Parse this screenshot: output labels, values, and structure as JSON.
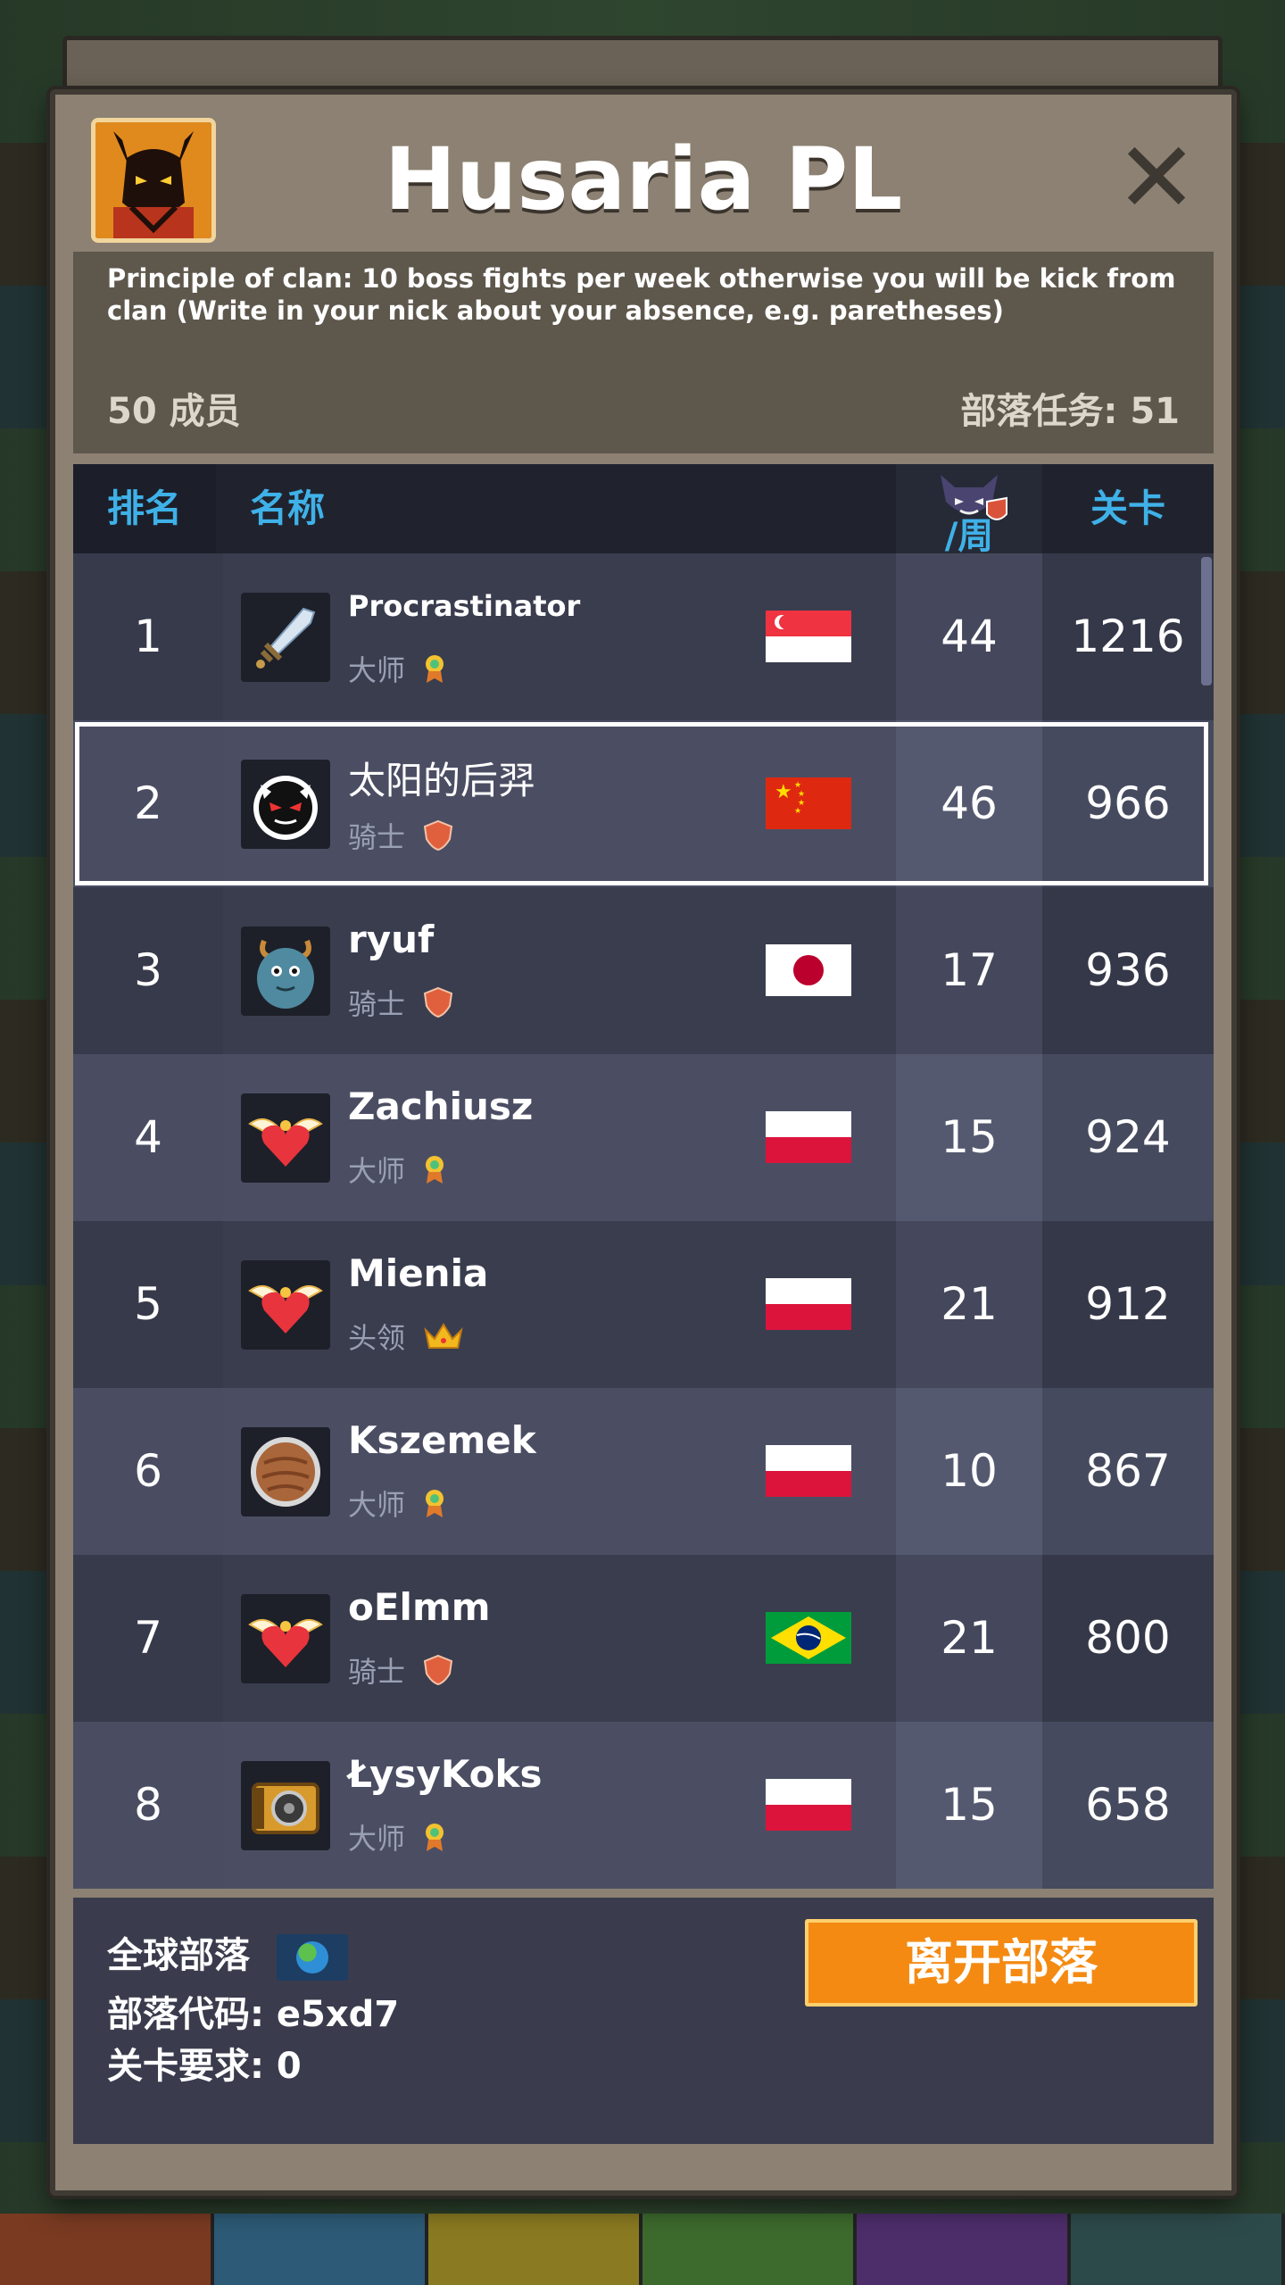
{
  "clan": {
    "name": "Husaria PL",
    "description": "Principle of clan: 10 boss fights per week otherwise you will be kick from clan (Write in your nick about your absence,  e.g. paretheses)",
    "members_text": "50 成员",
    "tasks_text": "部落任务: 51"
  },
  "table": {
    "headers": {
      "rank": "排名",
      "name": "名称",
      "week": "/周",
      "level": "关卡"
    },
    "rows": [
      {
        "rank": "1",
        "name": "Procrastinator",
        "role": "大师",
        "role_icon": "medal-icon",
        "flag": "singapore-flag",
        "week": "44",
        "level": "1216",
        "avatar": "sword-avatar"
      },
      {
        "rank": "2",
        "name": "太阳的后羿",
        "role": "骑士",
        "role_icon": "shield-icon",
        "flag": "china-flag",
        "week": "46",
        "level": "966",
        "avatar": "devil-face-avatar",
        "selected": true
      },
      {
        "rank": "3",
        "name": "ryuf",
        "role": "骑士",
        "role_icon": "shield-icon",
        "flag": "japan-flag",
        "week": "17",
        "level": "936",
        "avatar": "blue-monster-avatar"
      },
      {
        "rank": "4",
        "name": "Zachiusz",
        "role": "大师",
        "role_icon": "medal-icon",
        "flag": "poland-flag",
        "week": "15",
        "level": "924",
        "avatar": "winged-heart-avatar"
      },
      {
        "rank": "5",
        "name": "Mienia",
        "role": "头领",
        "role_icon": "crown-icon",
        "flag": "poland-flag",
        "week": "21",
        "level": "912",
        "avatar": "winged-heart-avatar"
      },
      {
        "rank": "6",
        "name": "Kszemek",
        "role": "大师",
        "role_icon": "medal-icon",
        "flag": "poland-flag",
        "week": "10",
        "level": "867",
        "avatar": "round-shield-avatar"
      },
      {
        "rank": "7",
        "name": "oElmm",
        "role": "骑士",
        "role_icon": "shield-icon",
        "flag": "brazil-flag",
        "week": "21",
        "level": "800",
        "avatar": "winged-heart-avatar"
      },
      {
        "rank": "8",
        "name": "ŁysyKoks",
        "role": "大师",
        "role_icon": "medal-icon",
        "flag": "poland-flag",
        "week": "15",
        "level": "658",
        "avatar": "treasure-chest-avatar"
      }
    ]
  },
  "footer": {
    "global_clan": "全球部落",
    "clan_code": "部落代码: e5xd7",
    "level_req": "关卡要求:  0",
    "leave_button": "离开部落"
  },
  "colors": {
    "accent_blue": "#3fb1e8",
    "leave_orange": "#f48a12",
    "panel_tan": "#8c8172"
  }
}
